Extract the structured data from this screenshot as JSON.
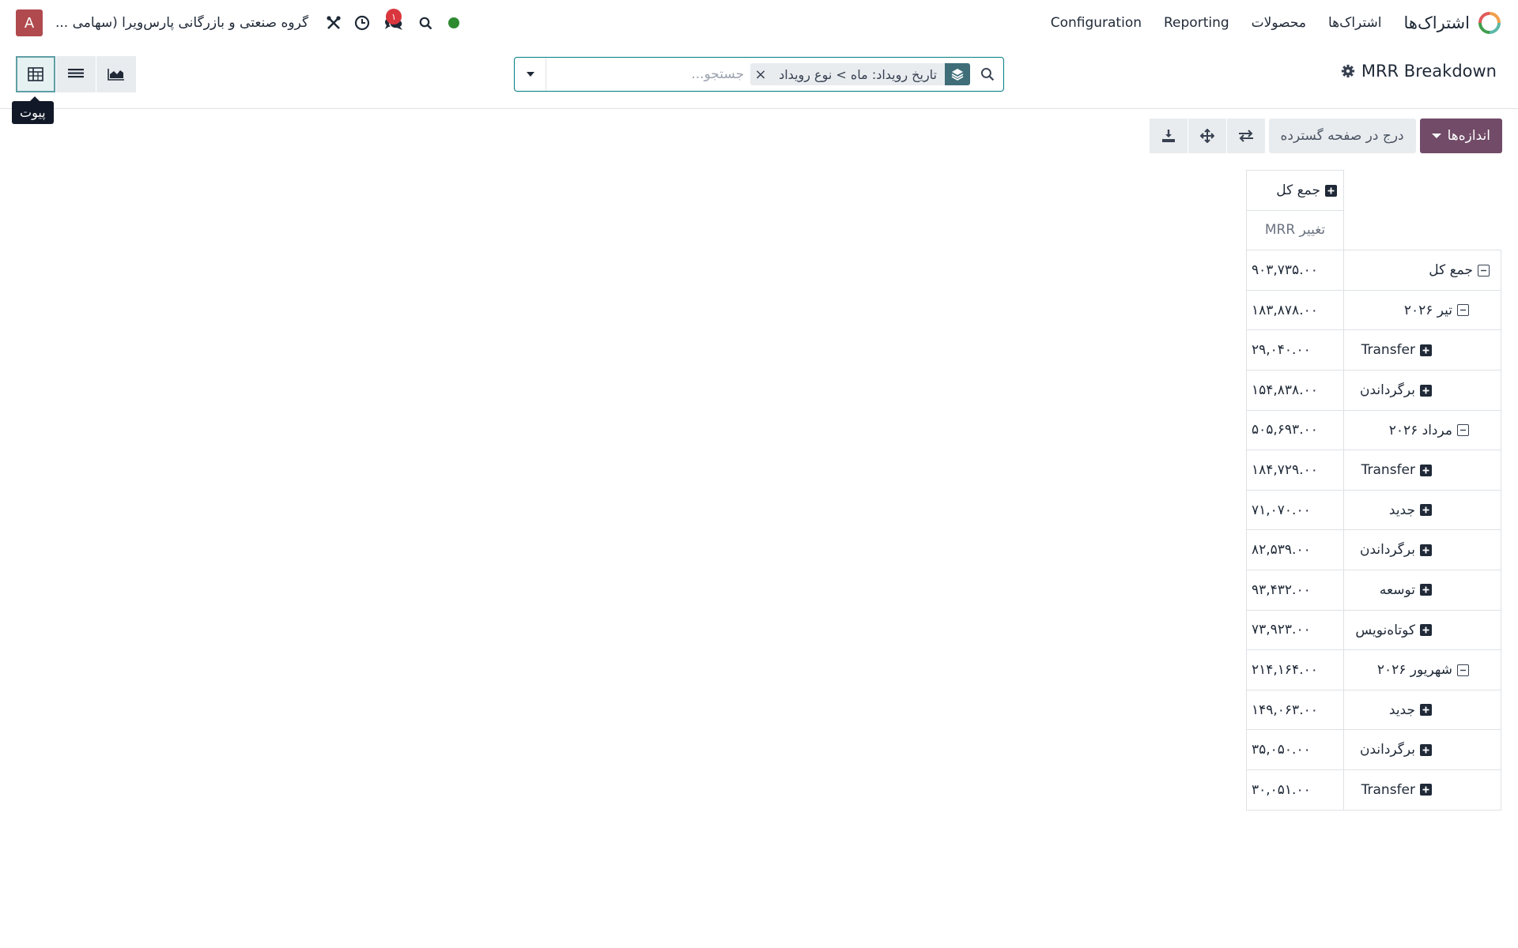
{
  "navbar": {
    "app_name": "اشتراک‌ها",
    "menu": [
      "اشتراک‌ها",
      "محصولات",
      "Reporting",
      "Configuration"
    ],
    "company": "گروه صنعتی و بازرگانی پارس‌ویرا (سهامی ...",
    "avatar_letter": "A",
    "messages_badge": "۱",
    "status_color": "#2d8a2f"
  },
  "control_panel": {
    "title": "MRR Breakdown",
    "search": {
      "facet": "تاریخ رویداد: ماه > نوع رویداد",
      "placeholder": "جستجو..."
    },
    "view_tooltip": "پیوت"
  },
  "pivot": {
    "measures_button": "اندازه‌ها",
    "insert_button": "درج در صفحه گسترده",
    "col_header": "جمع کل",
    "measure": "تغییر MRR",
    "rows": [
      {
        "label": "جمع کل",
        "value": "۹۰۳,۷۳۵.۰۰",
        "level": 0,
        "expanded": true
      },
      {
        "label": "تیر ۲۰۲۶",
        "value": "۱۸۳,۸۷۸.۰۰",
        "level": 1,
        "expanded": true
      },
      {
        "label": "Transfer",
        "value": "۲۹,۰۴۰.۰۰",
        "level": 2,
        "expanded": false
      },
      {
        "label": "برگرداندن",
        "value": "۱۵۴,۸۳۸.۰۰",
        "level": 2,
        "expanded": false
      },
      {
        "label": "مرداد ۲۰۲۶",
        "value": "۵۰۵,۶۹۳.۰۰",
        "level": 1,
        "expanded": true
      },
      {
        "label": "Transfer",
        "value": "۱۸۴,۷۲۹.۰۰",
        "level": 2,
        "expanded": false
      },
      {
        "label": "جدید",
        "value": "۷۱,۰۷۰.۰۰",
        "level": 2,
        "expanded": false
      },
      {
        "label": "برگرداندن",
        "value": "۸۲,۵۳۹.۰۰",
        "level": 2,
        "expanded": false
      },
      {
        "label": "توسعه",
        "value": "۹۳,۴۳۲.۰۰",
        "level": 2,
        "expanded": false
      },
      {
        "label": "کوتاه‌نویس",
        "value": "۷۳,۹۲۳.۰۰",
        "level": 2,
        "expanded": false
      },
      {
        "label": "شهریور ۲۰۲۶",
        "value": "۲۱۴,۱۶۴.۰۰",
        "level": 1,
        "expanded": true
      },
      {
        "label": "جدید",
        "value": "۱۴۹,۰۶۳.۰۰",
        "level": 2,
        "expanded": false
      },
      {
        "label": "برگرداندن",
        "value": "۳۵,۰۵۰.۰۰",
        "level": 2,
        "expanded": false
      },
      {
        "label": "Transfer",
        "value": "۳۰,۰۵۱.۰۰",
        "level": 2,
        "expanded": false
      }
    ]
  },
  "colors": {
    "accent": "#714b67",
    "facet_icon": "#3f6e78",
    "search_border": "#017e84"
  }
}
